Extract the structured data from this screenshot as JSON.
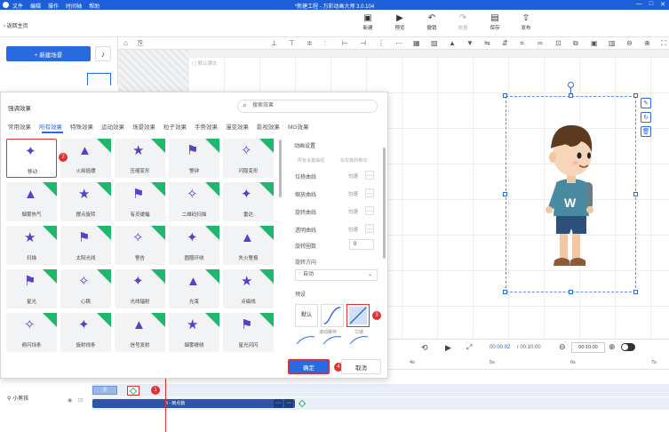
{
  "titlebar": {
    "menu": [
      "文件",
      "编辑",
      "操作",
      "时间轴",
      "帮助"
    ],
    "title": "*新建工程 - 万彩动画大师 3.0.104",
    "window_controls": [
      "—",
      "□",
      "✕"
    ]
  },
  "toolbar": {
    "back_label": "返回主页",
    "buttons": [
      {
        "label": "新建",
        "icon": "add-icon"
      },
      {
        "label": "预览",
        "icon": "play-icon"
      },
      {
        "label": "撤销",
        "icon": "undo-icon"
      },
      {
        "label": "恢复",
        "icon": "redo-icon"
      },
      {
        "label": "保存",
        "icon": "save-icon"
      },
      {
        "label": "发布",
        "icon": "publish-icon"
      }
    ]
  },
  "left_panel": {
    "new_scene_label": "+ 新建场景"
  },
  "canvas": {
    "label": "默认镜头"
  },
  "dialog": {
    "title": "强调效果",
    "search_placeholder": "搜索效果",
    "tabs": [
      "常用效果",
      "所有效果",
      "特殊效果",
      "运动效果",
      "场景效果",
      "粒子效果",
      "手势效果",
      "漫变效果",
      "影视效果",
      "MG效果"
    ],
    "active_tab": "所有效果",
    "effects": [
      [
        "移动",
        "火焰摇摆",
        "压缩变形",
        "警钟",
        "闪隐变形"
      ],
      [
        "烟雾热气",
        "摆点旋转",
        "有灵缓幅",
        "二维码扫描",
        "雷达"
      ],
      [
        "扫描",
        "太阳光线",
        "警告",
        "圆圈环绕",
        "失火警报"
      ],
      [
        "星光",
        "心跳",
        "光线辐射",
        "光束",
        "点缀线"
      ],
      [
        "频闪烁条",
        "旋射线条",
        "信号发射",
        "烟雾缭绕",
        "星光闪闪"
      ]
    ],
    "settings": {
      "title": "动画设置",
      "hint_left": "所有设置曲线",
      "hint_right": "实现真的移动",
      "rows": [
        {
          "label": "位移曲线",
          "value": "匀速"
        },
        {
          "label": "缩放曲线",
          "value": "匀速"
        },
        {
          "label": "旋转曲线",
          "value": "匀速"
        },
        {
          "label": "透明曲线",
          "value": "匀速"
        },
        {
          "label": "旋转圈数",
          "value": "0"
        }
      ],
      "rotate_dir_label": "旋转方向",
      "rotate_dir_value": "自动",
      "preset_label": "预设",
      "preset_default": "默认",
      "preset_caption_1": "滚动缓存",
      "preset_caption_2": "匀速"
    },
    "ok_label": "确定",
    "cancel_label": "取消",
    "badges": [
      "1",
      "2",
      "3",
      "4"
    ]
  },
  "playback": {
    "current_time": "00:00.92",
    "total_time": "/ 00:10.00",
    "zoom_value": "00:10.00"
  },
  "ruler": {
    "ticks": [
      "4s",
      "5s",
      "6s",
      "7s"
    ]
  },
  "timeline": {
    "role_label": "小男孩",
    "segment1_label": "无",
    "segment2_label": "8 - 雨点篇"
  },
  "colors": {
    "accent": "#2a6ae0",
    "highlight": "#e03030",
    "new_ribbon": "#1fb76b",
    "effect_icon": "#5a3fc8"
  }
}
